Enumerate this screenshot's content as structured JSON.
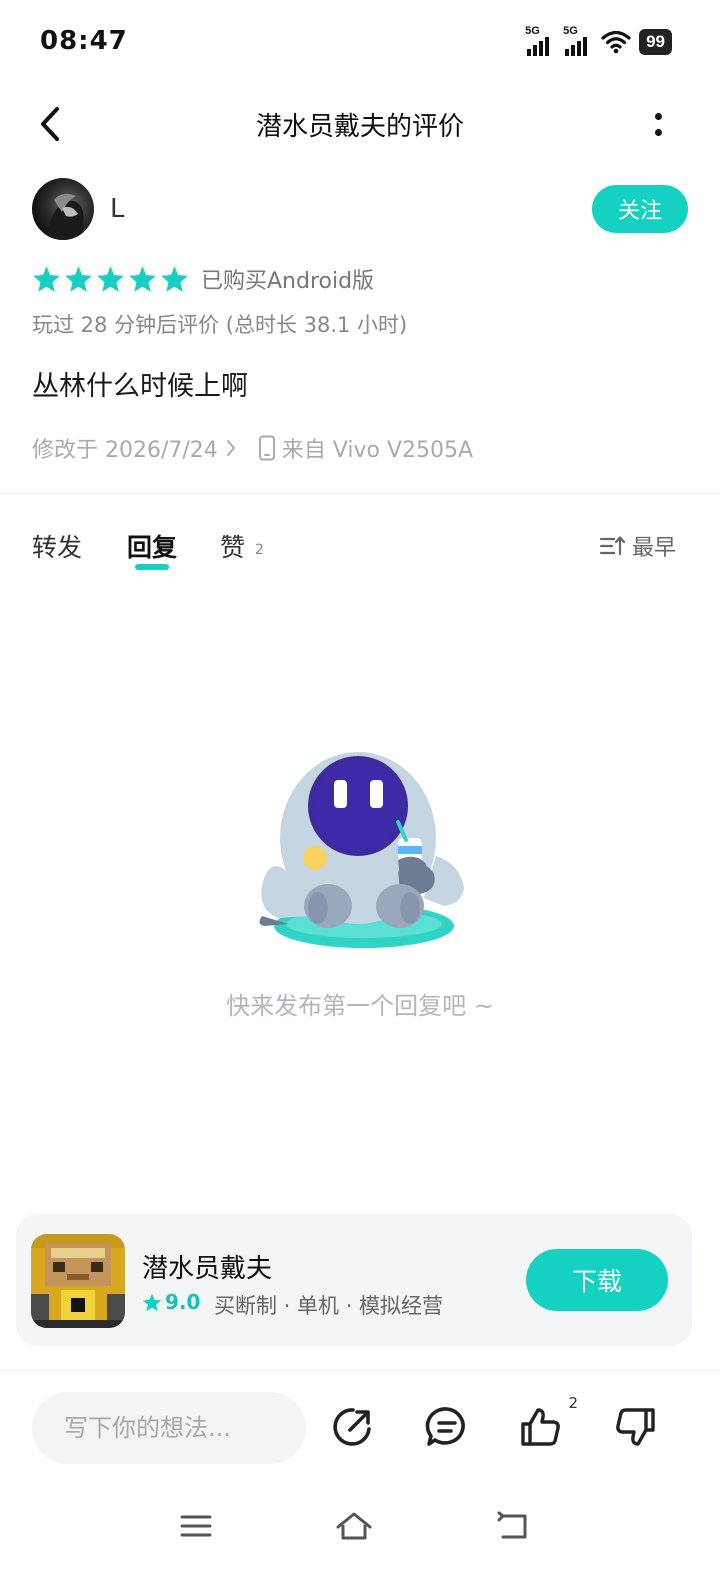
{
  "status_bar": {
    "time": "08:47",
    "signal_1": "5G",
    "signal_2": "5G",
    "battery": "99"
  },
  "header": {
    "title": "潜水员戴夫的评价"
  },
  "user": {
    "name": "L",
    "follow_label": "关注"
  },
  "review": {
    "stars": 5,
    "purchase_label": "已购买Android版",
    "playtime": "玩过 28 分钟后评价 (总时长 38.1 小时)",
    "text": "丛林什么时候上啊",
    "modified": "修改于 2026/7/24",
    "device": "来自 Vivo V2505A"
  },
  "tabs": {
    "forward": "转发",
    "reply": "回复",
    "like": "赞",
    "like_count": "2",
    "sort_label": "最早"
  },
  "empty_state": {
    "text": "快来发布第一个回复吧 ~"
  },
  "game_card": {
    "name": "潜水员戴夫",
    "score": "9.0",
    "tags": "买断制 · 单机 · 模拟经营",
    "download_label": "下载"
  },
  "bottom_bar": {
    "placeholder": "写下你的想法...",
    "like_count": "2"
  },
  "colors": {
    "accent": "#15d1c1",
    "text_primary": "#1a1a1a",
    "text_secondary": "#888888"
  },
  "icons": {
    "back": "chevron-left-icon",
    "more": "more-vertical-icon",
    "star": "star-icon",
    "share": "share-icon",
    "comment": "comment-icon",
    "like": "thumbs-up-icon",
    "dislike": "thumbs-down-icon"
  }
}
